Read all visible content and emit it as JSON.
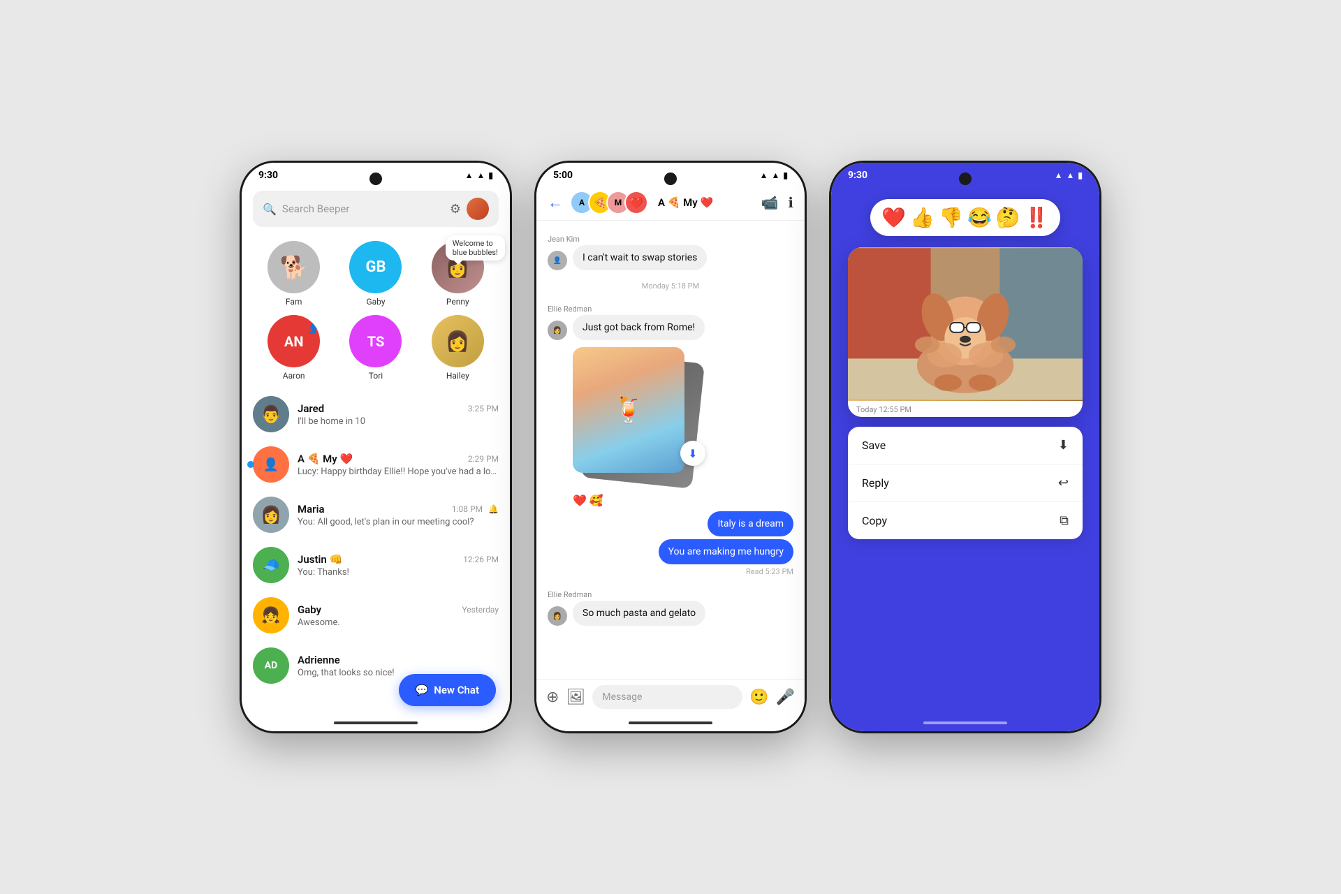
{
  "phone1": {
    "status_time": "9:30",
    "search_placeholder": "Search Beeper",
    "pinned": [
      {
        "id": "fam",
        "label": "Fam",
        "color": "#b0b0b0",
        "emoji": "🐕",
        "type": "dog"
      },
      {
        "id": "gaby",
        "label": "Gaby",
        "color": "#1db8f0",
        "initials": "GB",
        "type": "initials"
      },
      {
        "id": "penny",
        "label": "Penny",
        "color": "",
        "type": "photo",
        "online": true,
        "has_tooltip": true,
        "tooltip": "Welcome to blue bubbles!"
      }
    ],
    "pinned2": [
      {
        "id": "aaron",
        "label": "Aaron",
        "color": "#e53935",
        "initials": "AN",
        "type": "initials",
        "online": true,
        "overlay": true
      },
      {
        "id": "tori",
        "label": "Tori",
        "color": "#e040fb",
        "initials": "TS",
        "type": "initials"
      },
      {
        "id": "hailey",
        "label": "Hailey",
        "color": "#ffd54f",
        "type": "photo"
      }
    ],
    "chats": [
      {
        "id": "jared",
        "name": "Jared",
        "time": "3:25 PM",
        "preview": "I'll be home in 10",
        "unread": false,
        "bg": "#607d8b"
      },
      {
        "id": "group_a",
        "name": "A 🍕 My ❤️",
        "time": "2:29 PM",
        "preview": "Lucy: Happy birthday Ellie!! Hope you've had a lovely day 🙂",
        "unread": true,
        "bg": "#ff7043"
      },
      {
        "id": "maria",
        "name": "Maria",
        "time": "1:08 PM",
        "preview": "You: All good, let's plan in our meeting cool?",
        "unread": false,
        "bg": "#90a4ae",
        "muted": true
      },
      {
        "id": "justin",
        "name": "Justin 👊",
        "time": "12:26 PM",
        "preview": "You: Thanks!",
        "unread": false,
        "bg": "#4caf50"
      },
      {
        "id": "gaby2",
        "name": "Gaby",
        "time": "Yesterday",
        "preview": "Awesome.",
        "unread": false,
        "bg": "#ffb300"
      },
      {
        "id": "adrienne",
        "name": "Adrienne",
        "time": "",
        "preview": "Omg, that looks so nice!",
        "unread": false,
        "bg": "#4caf50",
        "initials": "AD"
      }
    ],
    "new_chat_label": "New Chat"
  },
  "phone2": {
    "status_time": "5:00",
    "header_title": "A 🍕 My ❤️",
    "messages": [
      {
        "id": "m1",
        "sender": "Jean Kim",
        "text": "I can't wait to swap stories",
        "type": "received"
      },
      {
        "id": "m2",
        "timestamp": "Monday 5:18 PM"
      },
      {
        "id": "m3",
        "sender": "Ellie Redman",
        "text": "Just got back from Rome!",
        "type": "received"
      },
      {
        "id": "m4",
        "type": "image_group"
      },
      {
        "id": "m5",
        "reactions": [
          "❤️",
          "🥰"
        ]
      },
      {
        "id": "m6",
        "text": "Italy is a dream",
        "type": "sent"
      },
      {
        "id": "m7",
        "text": "You are making me hungry",
        "type": "sent"
      },
      {
        "id": "m8",
        "read_label": "Read 5:23 PM"
      },
      {
        "id": "m9",
        "sender": "Ellie Redman",
        "text": "So much pasta and gelato",
        "type": "received"
      }
    ],
    "input_placeholder": "Message"
  },
  "phone3": {
    "status_time": "9:30",
    "emoji_reactions": [
      "❤️",
      "👍",
      "👎",
      "😂",
      "🤔",
      "‼️"
    ],
    "photo_timestamp": "Today  12:55 PM",
    "context_menu": [
      {
        "label": "Save",
        "icon": "⬇"
      },
      {
        "label": "Reply",
        "icon": "↩"
      },
      {
        "label": "Copy",
        "icon": "⧉"
      }
    ]
  }
}
